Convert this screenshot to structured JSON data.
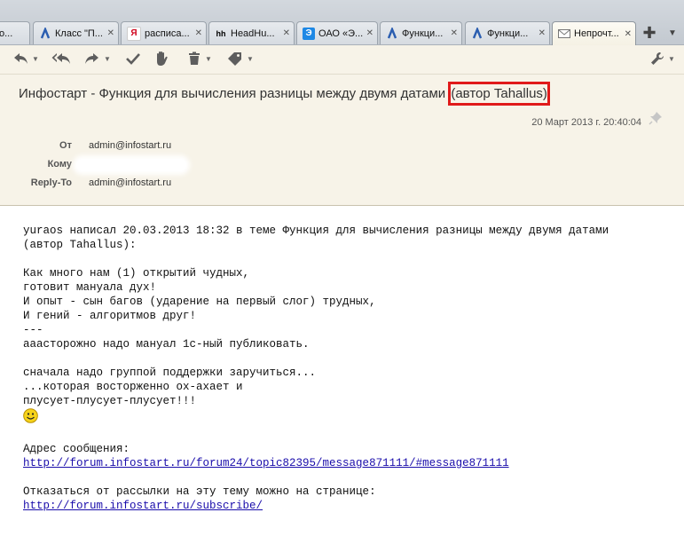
{
  "tabs": [
    {
      "label": "о...",
      "icon": "partial-tab-icon",
      "active": false
    },
    {
      "label": "Класс \"П...",
      "icon": "infostart-logo-icon",
      "active": false
    },
    {
      "label": "расписа...",
      "icon": "yandex-logo-icon",
      "icon_text": "Я",
      "active": false
    },
    {
      "label": "HeadHu...",
      "icon": "headhunter-logo-icon",
      "icon_text": "hh",
      "active": false
    },
    {
      "label": "ОАО «Э...",
      "icon": "company-logo-icon",
      "icon_text": "Э",
      "active": false
    },
    {
      "label": "Функци...",
      "icon": "infostart-logo-icon",
      "active": false
    },
    {
      "label": "Функци...",
      "icon": "infostart-logo-icon",
      "active": false
    },
    {
      "label": "Непрочт...",
      "icon": "envelope-icon",
      "active": true
    }
  ],
  "toolbar": {
    "buttons": [
      "reply-icon",
      "reply-all-icon",
      "forward-icon",
      "mark-read-icon",
      "junk-icon",
      "delete-icon",
      "tag-icon",
      "wrench-icon"
    ]
  },
  "message": {
    "subject": "Инфостарт - Функция для вычисления разницы между двумя датами",
    "subject_highlight": "(автор Tahallus)",
    "date": "20 Март 2013 г. 20:40:04",
    "headers": {
      "from_label": "От",
      "from_value": "admin@infostart.ru",
      "to_label": "Кому",
      "replyto_label": "Reply-To",
      "replyto_value": "admin@infostart.ru"
    },
    "body": {
      "line1": "yuraos написал 20.03.2013 18:32 в теме Функция для вычисления разницы между двумя датами",
      "line2": "(автор Tahallus):",
      "line3": "Как много нам (1) открытий чудных,",
      "line4": "готовит мануала дух!",
      "line5": "И опыт - сын багов (ударение на первый слог) трудных,",
      "line6": "И гений - алгоритмов друг!",
      "line7": "---",
      "line8": "ааасторожно надо мануал 1с-ный публиковать.",
      "line9": "сначала надо группой поддержки заручиться...",
      "line10": "...которая восторженно ох-ахает и",
      "line11": "плусует-плусует-плусует!!!",
      "addr_label": "Адрес сообщения:",
      "addr_link": "http://forum.infostart.ru/forum24/topic82395/message871111/#message871111",
      "unsub_label": "Отказаться от рассылки на эту тему можно на странице:",
      "unsub_link": "http://forum.infostart.ru/subscribe/"
    }
  },
  "colors": {
    "highlight_border": "#e01a1a",
    "link": "#1a0dab",
    "header_bg": "#f7f3e8"
  }
}
